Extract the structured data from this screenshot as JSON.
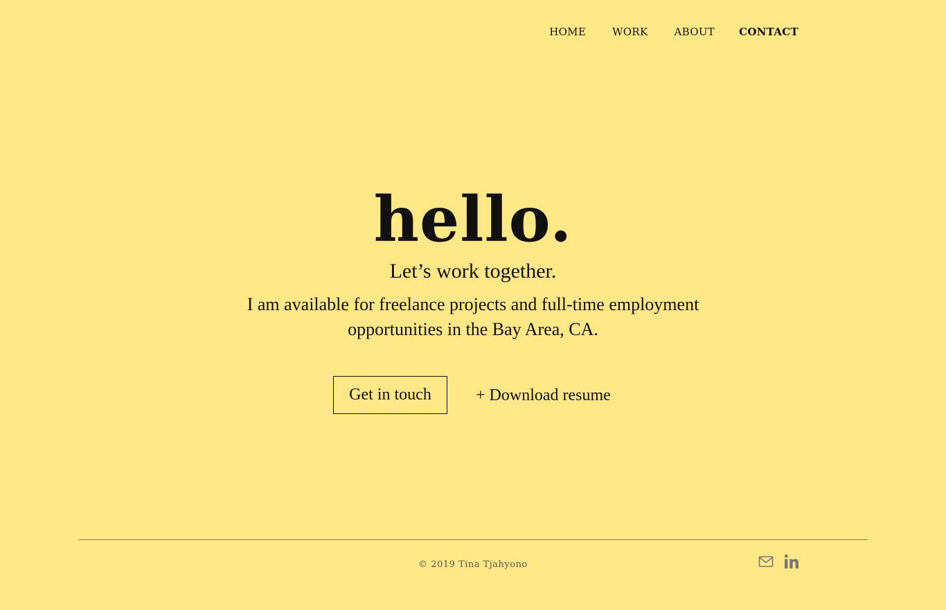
{
  "nav": {
    "items": [
      {
        "label": "HOME"
      },
      {
        "label": "WORK"
      },
      {
        "label": "ABOUT"
      },
      {
        "label": "CONTACT",
        "active": true
      }
    ]
  },
  "hero": {
    "title": "hello.",
    "subtitle": "Let’s work together.",
    "description": "I am available for freelance projects and full-time employment opportunities in the Bay Area, CA."
  },
  "cta": {
    "primary_label": "Get in touch",
    "secondary_label": "+ Download resume"
  },
  "footer": {
    "copyright": "© 2019 Tina Tjahyono",
    "social": [
      {
        "icon": "mail-icon",
        "label": "Email"
      },
      {
        "icon": "linkedin-icon",
        "label": "LinkedIn"
      }
    ]
  },
  "colors": {
    "background": "#FFE885",
    "text": "#111111",
    "muted": "#777777"
  }
}
